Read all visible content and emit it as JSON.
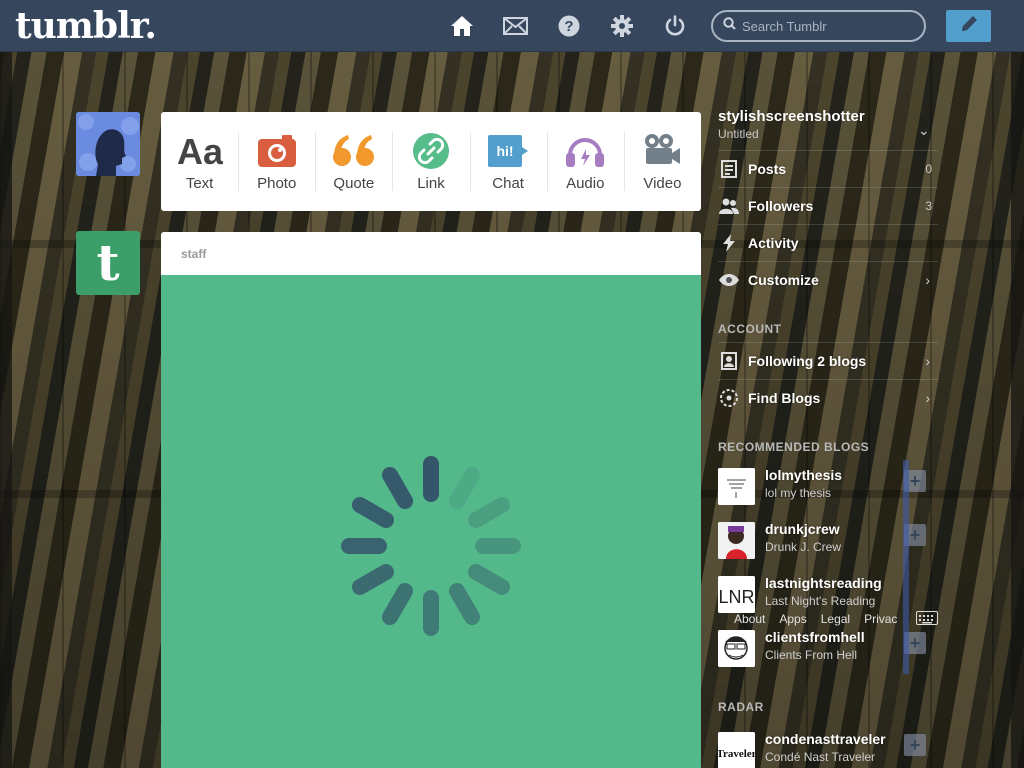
{
  "header": {
    "logo": "tumblr.",
    "search_placeholder": "Search Tumblr",
    "nav_icons": [
      "home-icon",
      "mail-icon",
      "help-icon",
      "gear-icon",
      "power-icon"
    ],
    "colors": {
      "bar": "#36465d",
      "compose": "#529ecc"
    }
  },
  "post_types": [
    {
      "label": "Text",
      "icon": "text-icon",
      "color": "#444444"
    },
    {
      "label": "Photo",
      "icon": "camera-icon",
      "color": "#d95e40"
    },
    {
      "label": "Quote",
      "icon": "quote-icon",
      "color": "#f2992e"
    },
    {
      "label": "Link",
      "icon": "link-icon",
      "color": "#56bc8a"
    },
    {
      "label": "Chat",
      "icon": "chat-icon",
      "color": "#529ecc"
    },
    {
      "label": "Audio",
      "icon": "headphones-icon",
      "color": "#a77dc2"
    },
    {
      "label": "Video",
      "icon": "video-camera-icon",
      "color": "#748089"
    }
  ],
  "staff_avatar": {
    "letter": "t"
  },
  "post": {
    "author": "staff",
    "color": "#53b98a"
  },
  "sidebar": {
    "blog_name": "stylishscreenshotter",
    "blog_subtitle": "Untitled",
    "rows": {
      "posts": {
        "label": "Posts",
        "count": "0"
      },
      "followers": {
        "label": "Followers",
        "count": "3"
      },
      "activity": {
        "label": "Activity"
      },
      "customize": {
        "label": "Customize"
      }
    },
    "account_heading": "ACCOUNT",
    "following": "Following 2 blogs",
    "find_blogs": "Find Blogs",
    "recommended_heading": "RECOMMENDED BLOGS",
    "recommended": [
      {
        "name": "lolmythesis",
        "subtitle": "lol my thesis"
      },
      {
        "name": "drunkjcrew",
        "subtitle": "Drunk J. Crew"
      },
      {
        "name": "lastnightsreading",
        "subtitle": "Last Night's Reading",
        "avatar_text": "LNR"
      },
      {
        "name": "clientsfromhell",
        "subtitle": "Clients From Hell"
      }
    ],
    "radar_heading": "RADAR",
    "radar": {
      "name": "condenasttraveler",
      "subtitle": "Condé Nast Traveler",
      "avatar_text": "Traveler"
    },
    "footer_links": [
      "About",
      "Apps",
      "Legal",
      "Privac"
    ]
  }
}
